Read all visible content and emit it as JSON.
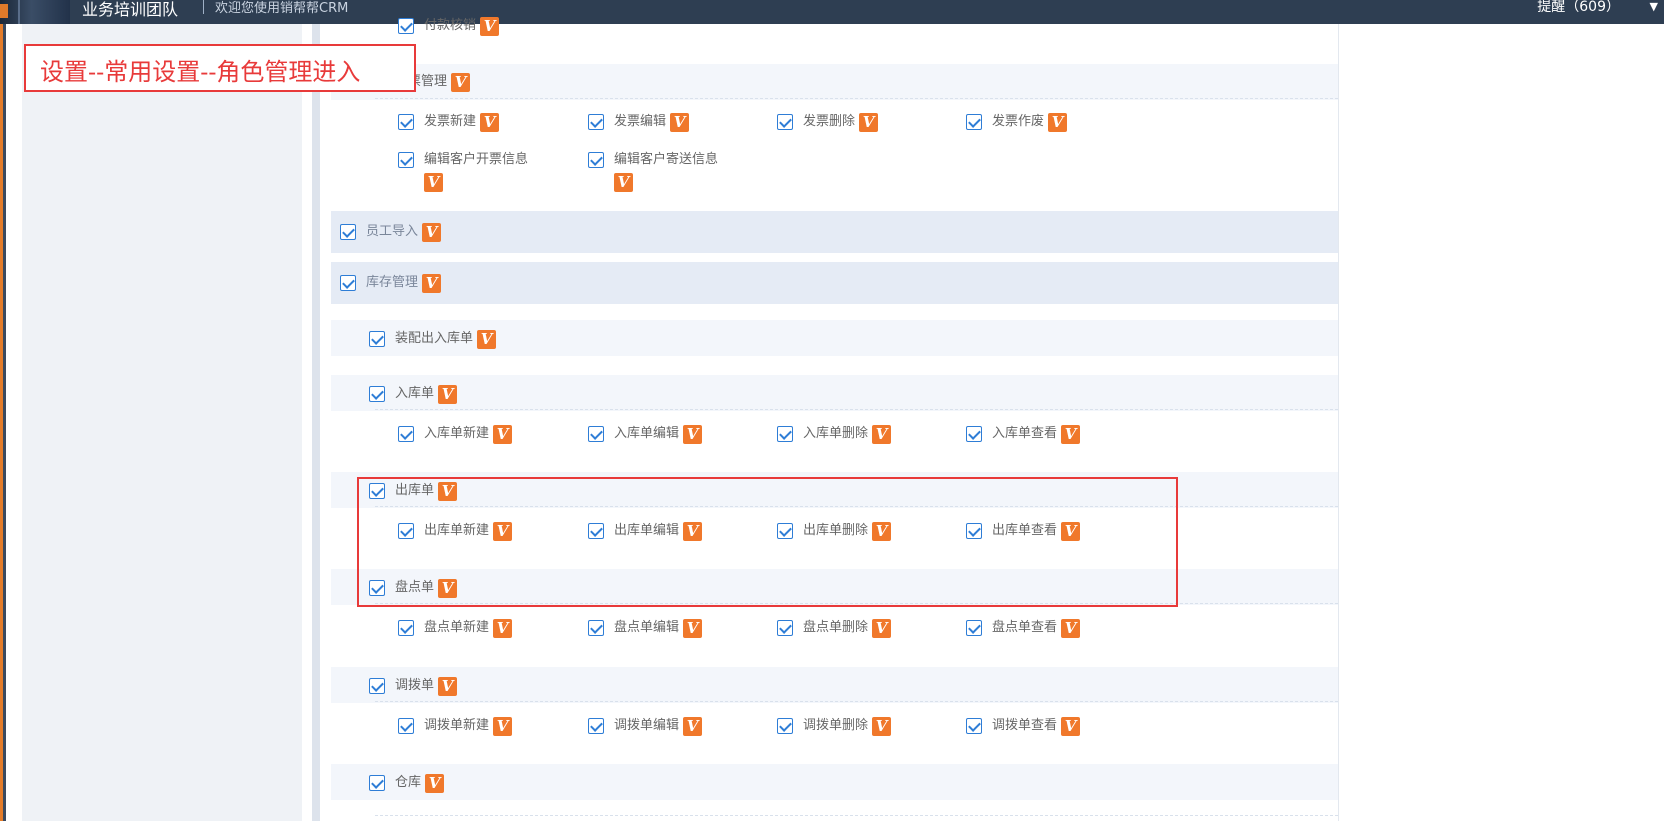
{
  "header": {
    "team_name": "业务培训团队",
    "welcome": "欢迎您使用销帮帮CRM",
    "reminder": "提醒（609）",
    "caret_icon": "chevron-down-icon"
  },
  "annotation": {
    "instruction": "设置--常用设置--角色管理进入",
    "color": "#e83a3a"
  },
  "badge": {
    "label": "V",
    "color": "#f0782b"
  },
  "checkbox_color": "#2e7dd6",
  "top_item": {
    "label": "付款核销"
  },
  "invoice": {
    "label": "发票管理",
    "perms": [
      "发票新建",
      "发票编辑",
      "发票删除",
      "发票作废",
      "编辑客户开票信息",
      "编辑客户寄送信息"
    ]
  },
  "employee_import": {
    "label": "员工导入"
  },
  "inventory": {
    "label": "库存管理",
    "assembly": {
      "label": "装配出入库单"
    },
    "inbound": {
      "label": "入库单",
      "perms": [
        "入库单新建",
        "入库单编辑",
        "入库单删除",
        "入库单查看"
      ]
    },
    "outbound": {
      "label": "出库单",
      "perms": [
        "出库单新建",
        "出库单编辑",
        "出库单删除",
        "出库单查看"
      ]
    },
    "stocktake": {
      "label": "盘点单",
      "perms": [
        "盘点单新建",
        "盘点单编辑",
        "盘点单删除",
        "盘点单查看"
      ]
    },
    "transfer": {
      "label": "调拨单",
      "perms": [
        "调拨单新建",
        "调拨单编辑",
        "调拨单删除",
        "调拨单查看"
      ]
    },
    "warehouse": {
      "label": "仓库"
    }
  }
}
